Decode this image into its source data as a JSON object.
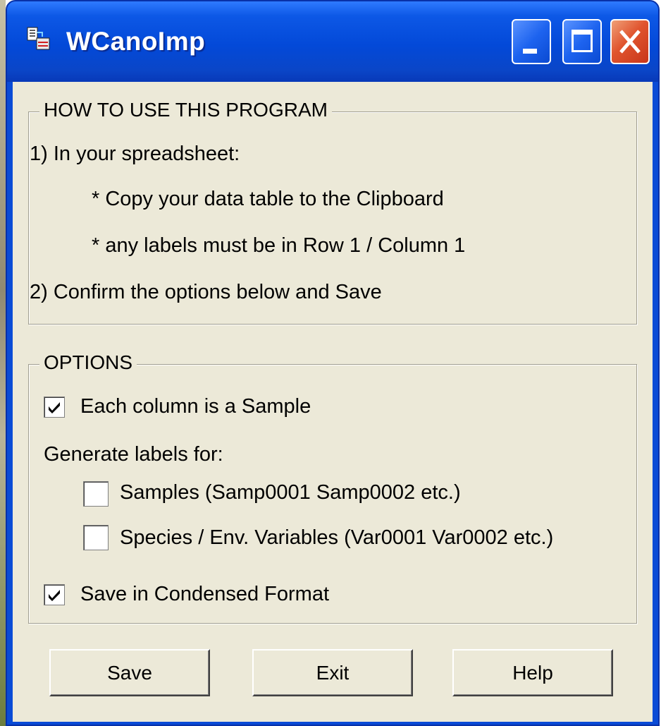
{
  "window": {
    "title": "WCanoImp",
    "icon": "app-icon",
    "controls": [
      "minimize-icon",
      "maximize-icon",
      "close-icon"
    ],
    "accent_color": "#0a4bd6",
    "close_color": "#e0542e",
    "face_color": "#ece9d8"
  },
  "howto": {
    "legend": "HOW TO USE THIS PROGRAM",
    "step1": "1) In your spreadsheet:",
    "bullet1": "* Copy your data table to the Clipboard",
    "bullet2": "* any labels must be in Row 1  /  Column 1",
    "step2": "2) Confirm the options below and Save"
  },
  "options": {
    "legend": "OPTIONS",
    "each_column": {
      "label": "Each column is a Sample",
      "checked": true
    },
    "generate_label": "Generate labels for:",
    "samples": {
      "label": "Samples (Samp0001 Samp0002 etc.)",
      "checked": false
    },
    "species": {
      "label": "Species / Env. Variables (Var0001 Var0002 etc.)",
      "checked": false
    },
    "condensed": {
      "label": "Save in Condensed Format",
      "checked": true
    }
  },
  "buttons": {
    "save": "Save",
    "exit": "Exit",
    "help": "Help"
  }
}
